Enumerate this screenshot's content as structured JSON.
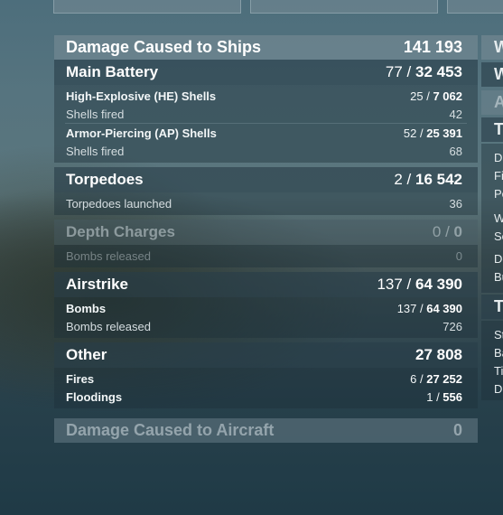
{
  "top_buttons": [
    "══ # ══ ",
    "══ # ══ "
  ],
  "damage_ships": {
    "title": "Damage Caused to Ships",
    "total": "141 193",
    "main_battery": {
      "title": "Main Battery",
      "hits": "77",
      "sep": " / ",
      "damage": "32 453",
      "he_label": "High-Explosive (HE) Shells",
      "he_hits": "25",
      "he_damage": "7 062",
      "he_fired_label": "Shells fired",
      "he_fired": "42",
      "ap_label": "Armor-Piercing (AP) Shells",
      "ap_hits": "52",
      "ap_damage": "25 391",
      "ap_fired_label": "Shells fired",
      "ap_fired": "68"
    },
    "torpedoes": {
      "title": "Torpedoes",
      "hits": "2",
      "damage": "16 542",
      "launched_label": "Torpedoes launched",
      "launched": "36"
    },
    "depth_charges": {
      "title": "Depth Charges",
      "hits": "0",
      "damage": "0",
      "released_label": "Bombs released",
      "released": "0"
    },
    "airstrike": {
      "title": "Airstrike",
      "hits": "137",
      "damage": "64 390",
      "bombs_label": "Bombs",
      "bombs_hits": "137",
      "bombs_damage": "64 390",
      "released_label": "Bombs released",
      "released": "726"
    },
    "other": {
      "title": "Other",
      "total": "27 808",
      "fires_label": "Fires",
      "fires_hits": "6",
      "fires_damage": "27 252",
      "floodings_label": "Floodings",
      "floodings_hits": "1",
      "floodings_damage": "556"
    }
  },
  "damage_aircraft": {
    "title": "Damage Caused to Aircraft",
    "total": "0"
  },
  "side": {
    "letters_top": [
      "W",
      "W",
      "A",
      "T"
    ],
    "list1": [
      "Da",
      "Fi",
      "Pe",
      "W",
      "Se",
      "De",
      "Bu"
    ],
    "header2": "T",
    "list2": [
      "St",
      "Ba",
      "Ti",
      "Di"
    ]
  }
}
